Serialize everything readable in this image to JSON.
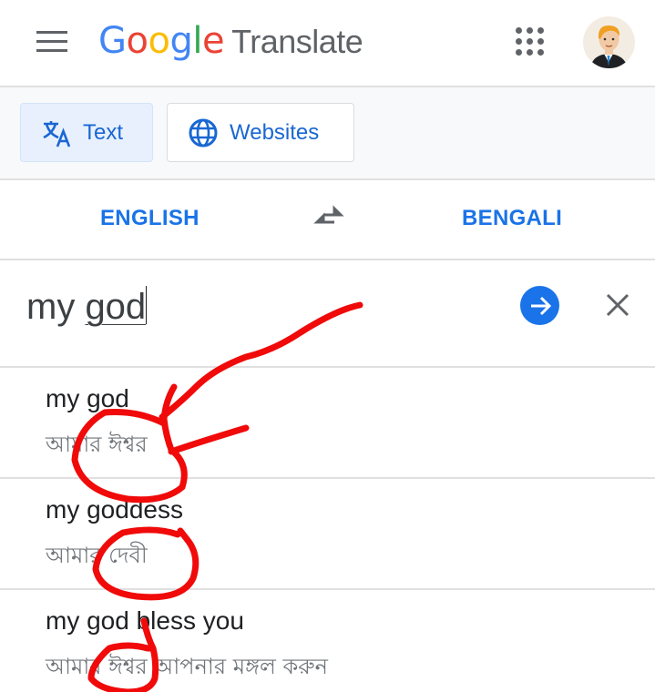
{
  "header": {
    "logo_letters": [
      "G",
      "o",
      "o",
      "g",
      "l",
      "e"
    ],
    "product_name": "Translate",
    "menu_icon": "hamburger-menu-icon",
    "apps_icon": "apps-grid-icon",
    "avatar_icon": "user-avatar"
  },
  "modes": {
    "items": [
      {
        "label": "Text",
        "icon": "translate-icon",
        "active": true
      },
      {
        "label": "Websites",
        "icon": "globe-icon",
        "active": false
      }
    ]
  },
  "languages": {
    "source": "ENGLISH",
    "target": "BENGALI",
    "swap_icon": "swap-arrows-icon"
  },
  "input": {
    "value_plain": "my ",
    "value_underlined": "god",
    "go_icon": "arrow-forward-icon",
    "clear_icon": "close-icon"
  },
  "suggestions": [
    {
      "source": "my god",
      "translation": "আমার ঈশ্বর"
    },
    {
      "source": "my goddess",
      "translation": "আমার দেবী"
    },
    {
      "source": "my god bless you",
      "translation": "আমার ঈশ্বর আপনার মঙ্গল করুন"
    }
  ],
  "colors": {
    "accent_blue": "#1a73e8",
    "active_mode_bg": "#e8f0fe",
    "annotation_red": "#f00a0a"
  }
}
